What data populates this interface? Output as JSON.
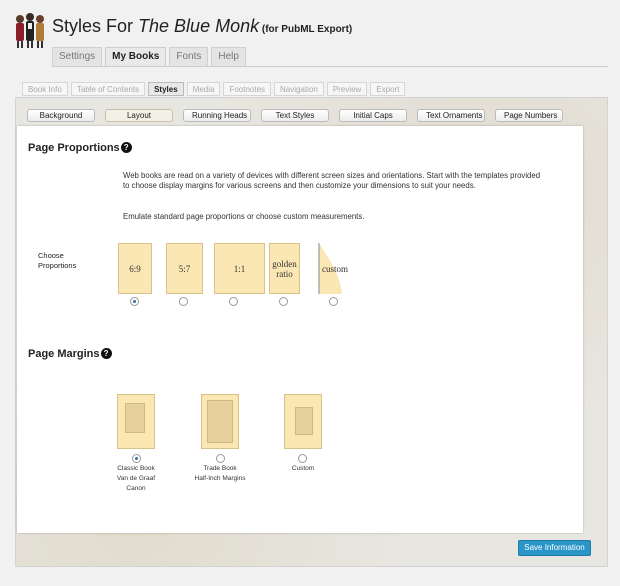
{
  "header": {
    "title_prefix": "Styles For ",
    "title_book": "The Blue Monk",
    "title_suffix": " (for PubML Export)",
    "main_tabs": [
      {
        "label": "Settings",
        "active": false
      },
      {
        "label": "My Books",
        "active": true
      },
      {
        "label": "Fonts",
        "active": false
      },
      {
        "label": "Help",
        "active": false
      }
    ]
  },
  "sub_tabs": [
    {
      "label": "Book Info",
      "active": false
    },
    {
      "label": "Table of Contents",
      "active": false
    },
    {
      "label": "Styles",
      "active": true
    },
    {
      "label": "Media",
      "active": false
    },
    {
      "label": "Footnotes",
      "active": false
    },
    {
      "label": "Navigation",
      "active": false
    },
    {
      "label": "Preview",
      "active": false
    },
    {
      "label": "Export",
      "active": false
    }
  ],
  "style_tabs": [
    {
      "label": "Background",
      "active": false
    },
    {
      "label": "Layout",
      "active": true
    },
    {
      "label": "Running Heads",
      "active": false
    },
    {
      "label": "Text Styles",
      "active": false
    },
    {
      "label": "Initial Caps",
      "active": false
    },
    {
      "label": "Text Ornaments",
      "active": false
    },
    {
      "label": "Page Numbers",
      "active": false
    }
  ],
  "page_proportions": {
    "title": "Page Proportions",
    "help_icon": "question-circle-icon",
    "description_1": "Web books are read on a variety of devices with different screen sizes and orientations. Start with the templates provided to choose display margins for various screens and then customize your dimensions to suit your needs.",
    "description_2": "Emulate standard page proportions or choose custom measurements.",
    "choose_label": "Choose Proportions",
    "options": [
      {
        "label": "6:9",
        "selected": true
      },
      {
        "label": "5:7",
        "selected": false
      },
      {
        "label": "1:1",
        "selected": false
      },
      {
        "label": "golden ratio",
        "selected": false
      },
      {
        "label": "custom",
        "selected": false
      }
    ]
  },
  "page_margins": {
    "title": "Page Margins",
    "help_icon": "question-circle-icon",
    "options": [
      {
        "line1": "Classic Book",
        "line2": "Van de Graaf",
        "line3": "Canon",
        "selected": true
      },
      {
        "line1": "Trade Book",
        "line2": "Half-Inch Margins",
        "line3": "",
        "selected": false
      },
      {
        "line1": "Custom",
        "line2": "",
        "line3": "",
        "selected": false
      }
    ]
  },
  "save_button": "Save Information",
  "colors": {
    "accent": "#2a95c9",
    "page_swatch": "#fbe7b4"
  }
}
